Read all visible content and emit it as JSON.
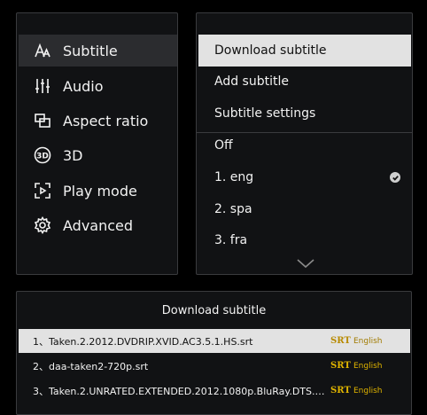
{
  "sidebar": {
    "items": [
      {
        "label": "Subtitle",
        "icon": "font-size-icon"
      },
      {
        "label": "Audio",
        "icon": "equalizer-icon"
      },
      {
        "label": "Aspect ratio",
        "icon": "aspect-ratio-icon"
      },
      {
        "label": "3D",
        "icon": "3d-icon"
      },
      {
        "label": "Play mode",
        "icon": "play-mode-icon"
      },
      {
        "label": "Advanced",
        "icon": "gear-icon"
      }
    ]
  },
  "menu": {
    "actions": [
      "Download subtitle",
      "Add subtitle",
      "Subtitle settings"
    ],
    "tracks": [
      "Off",
      "1. eng",
      "2. spa",
      "3. fra"
    ]
  },
  "download": {
    "title": "Download subtitle",
    "files": [
      {
        "name": "1、Taken.2.2012.DVDRIP.XVID.AC3.5.1.HS.srt",
        "format": "SRT",
        "language": "English"
      },
      {
        "name": "2、daa-taken2-720p.srt",
        "format": "SRT",
        "language": "English"
      },
      {
        "name": "3、Taken.2.UNRATED.EXTENDED.2012.1080p.BluRay.DTS.x264-...",
        "format": "SRT",
        "language": "English"
      }
    ]
  },
  "colors": {
    "highlight": "#e2e2e2",
    "accent": "#e0b400",
    "panel": "#111214"
  }
}
